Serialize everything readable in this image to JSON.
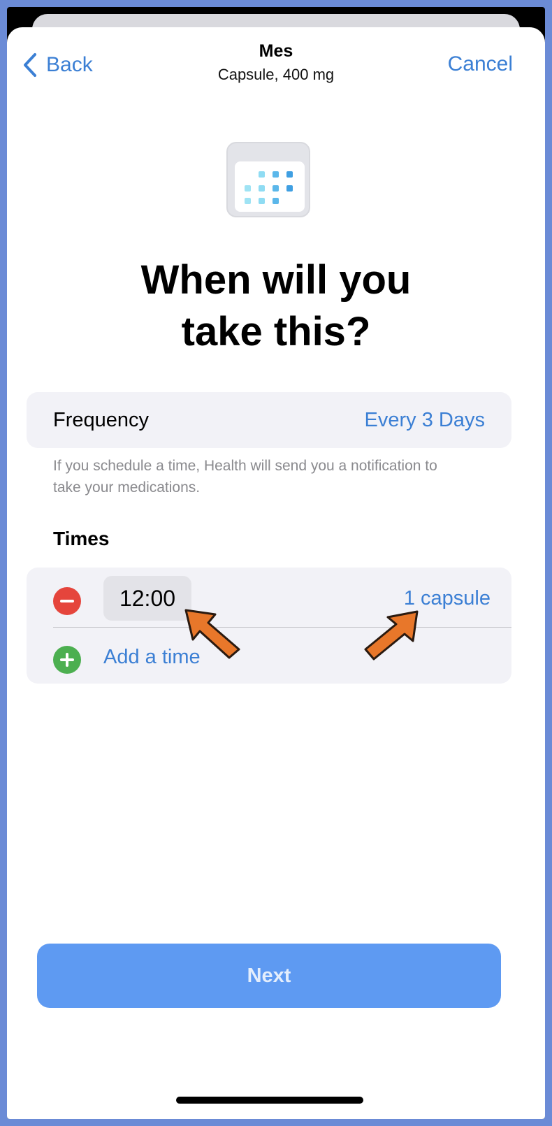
{
  "nav": {
    "back_label": "Back",
    "cancel_label": "Cancel",
    "title": "Mes",
    "subtitle": "Capsule, 400 mg"
  },
  "headline": {
    "line1": "When will you",
    "line2": "take this?"
  },
  "frequency": {
    "label": "Frequency",
    "value": "Every 3 Days"
  },
  "note": "If you schedule a time, Health will send you a notification to take your medications.",
  "times": {
    "label": "Times",
    "items": [
      {
        "time": "12:00",
        "dose": "1 capsule"
      }
    ],
    "add_label": "Add a time"
  },
  "next_label": "Next",
  "colors": {
    "accent": "#3b7fd4",
    "remove": "#e5453c",
    "add": "#4caf50",
    "next_button": "#5e9af2",
    "annotation_arrow": "#e8772a",
    "page_border": "#6b8bd6"
  },
  "icons": {
    "back": "chevron-left-icon",
    "header": "calendar-icon",
    "remove": "minus-circle-icon",
    "add": "plus-circle-icon"
  }
}
